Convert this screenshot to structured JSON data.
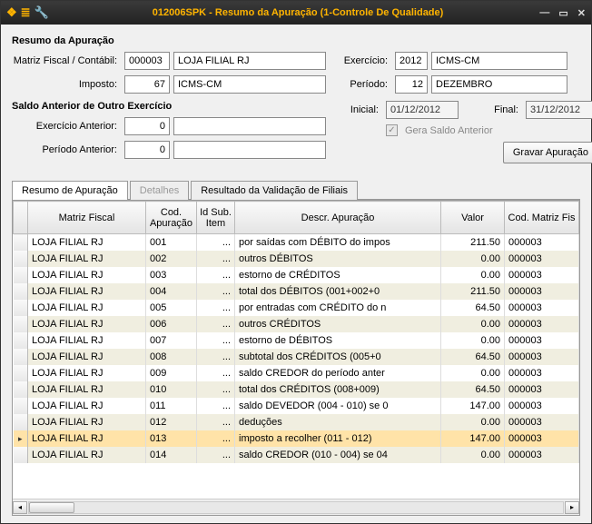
{
  "window": {
    "title": "012006SPK - Resumo da Apuração (1-Controle De Qualidade)"
  },
  "labels": {
    "section1": "Resumo da Apuração",
    "matriz": "Matriz Fiscal / Contábil:",
    "imposto": "Imposto:",
    "exercicio": "Exercício:",
    "periodo": "Período:",
    "section2": "Saldo Anterior de Outro Exercício",
    "exercicio_ant": "Exercício Anterior:",
    "periodo_ant": "Período Anterior:",
    "inicial": "Inicial:",
    "final": "Final:",
    "gera_saldo": "Gera Saldo Anterior",
    "btn_gravar": "Gravar Apuração"
  },
  "fields": {
    "matriz_cod": "000003",
    "matriz_nome": "LOJA FILIAL RJ",
    "imposto_cod": "67",
    "imposto_nome": "ICMS-CM",
    "exercicio_cod": "2012",
    "exercicio_nome": "ICMS-CM",
    "periodo_cod": "12",
    "periodo_nome": "DEZEMBRO",
    "exercicio_ant": "0",
    "periodo_ant": "0",
    "data_inicial": "01/12/2012",
    "data_final": "31/12/2012"
  },
  "tabs": {
    "t0": "Resumo de Apuração",
    "t1": "Detalhes",
    "t2": "Resultado da Validação de Filiais"
  },
  "grid": {
    "headers": {
      "h1": "Matriz Fiscal",
      "h2": "Cod. Apuração",
      "h3": "Id Sub. Item",
      "h4": "Descr. Apuração",
      "h5": "Valor",
      "h6": "Cod. Matriz Fis"
    },
    "rows": [
      {
        "mf": "LOJA FILIAL RJ",
        "cod": "001",
        "sub": "...",
        "desc": "por saídas com DÉBITO do impos",
        "valor": "211.50",
        "cmf": "000003"
      },
      {
        "mf": "LOJA FILIAL RJ",
        "cod": "002",
        "sub": "...",
        "desc": "outros DÉBITOS",
        "valor": "0.00",
        "cmf": "000003"
      },
      {
        "mf": "LOJA FILIAL RJ",
        "cod": "003",
        "sub": "...",
        "desc": "estorno de CRÉDITOS",
        "valor": "0.00",
        "cmf": "000003"
      },
      {
        "mf": "LOJA FILIAL RJ",
        "cod": "004",
        "sub": "...",
        "desc": "total dos DÉBITOS (001+002+0",
        "valor": "211.50",
        "cmf": "000003"
      },
      {
        "mf": "LOJA FILIAL RJ",
        "cod": "005",
        "sub": "...",
        "desc": "por entradas com CRÉDITO do n",
        "valor": "64.50",
        "cmf": "000003"
      },
      {
        "mf": "LOJA FILIAL RJ",
        "cod": "006",
        "sub": "...",
        "desc": "outros CRÉDITOS",
        "valor": "0.00",
        "cmf": "000003"
      },
      {
        "mf": "LOJA FILIAL RJ",
        "cod": "007",
        "sub": "...",
        "desc": "estorno de DÉBITOS",
        "valor": "0.00",
        "cmf": "000003"
      },
      {
        "mf": "LOJA FILIAL RJ",
        "cod": "008",
        "sub": "...",
        "desc": "subtotal dos CRÉDITOS (005+0",
        "valor": "64.50",
        "cmf": "000003"
      },
      {
        "mf": "LOJA FILIAL RJ",
        "cod": "009",
        "sub": "...",
        "desc": "saldo CREDOR do período anter",
        "valor": "0.00",
        "cmf": "000003"
      },
      {
        "mf": "LOJA FILIAL RJ",
        "cod": "010",
        "sub": "...",
        "desc": "total dos CRÉDITOS (008+009)",
        "valor": "64.50",
        "cmf": "000003"
      },
      {
        "mf": "LOJA FILIAL RJ",
        "cod": "011",
        "sub": "...",
        "desc": "saldo DEVEDOR (004 - 010) se 0",
        "valor": "147.00",
        "cmf": "000003"
      },
      {
        "mf": "LOJA FILIAL RJ",
        "cod": "012",
        "sub": "...",
        "desc": "deduções",
        "valor": "0.00",
        "cmf": "000003"
      },
      {
        "mf": "LOJA FILIAL RJ",
        "cod": "013",
        "sub": "...",
        "desc": "imposto a recolher (011 - 012)",
        "valor": "147.00",
        "cmf": "000003",
        "selected": true
      },
      {
        "mf": "LOJA FILIAL RJ",
        "cod": "014",
        "sub": "...",
        "desc": "saldo CREDOR (010 - 004) se 04",
        "valor": "0.00",
        "cmf": "000003"
      }
    ]
  }
}
